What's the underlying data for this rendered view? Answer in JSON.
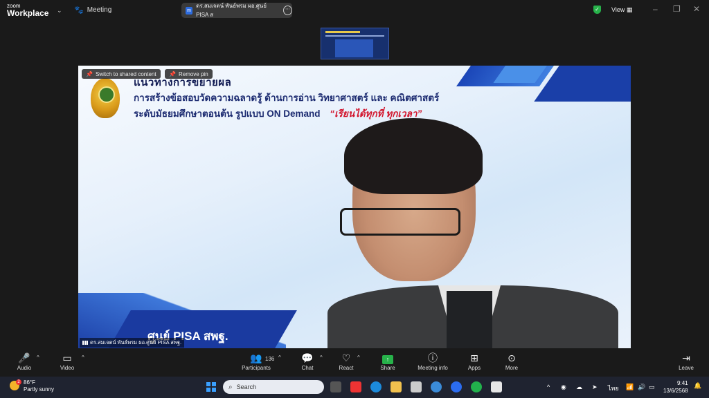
{
  "app": {
    "logo_line1": "zoom",
    "logo_line2": "Workplace",
    "meeting_label": "Meeting",
    "view_label": "View"
  },
  "speaker_pill": {
    "text": "ดร.สมเจตน์ พันธ์พรม ผอ.ศูนย์ PISA ส"
  },
  "slide": {
    "title": "แนวทางการขยายผล",
    "line1": "การสร้างข้อสอบวัดความฉลาดรู้ ด้านการอ่าน วิทยาศาสตร์ และ คณิตศาสตร์",
    "line2": "ระดับมัธยมศึกษาตอนต้น รูปแบบ ON Demand",
    "line2_highlight": "“เรียนได้ทุกที่ ทุกเวลา”",
    "brand": "ศูนย์ PISA สพฐ."
  },
  "overlay": {
    "switch_label": "Switch to shared content",
    "remove_pin_label": "Remove pin"
  },
  "video_name": "ดร.สมเจตน์ พันธ์พรม ผอ.ศูนย์ PISA สพฐ.",
  "controls": {
    "audio": "Audio",
    "video": "Video",
    "participants": "Participants",
    "participants_count": "136",
    "chat": "Chat",
    "react": "React",
    "share": "Share",
    "meeting_info": "Meeting info",
    "apps": "Apps",
    "more": "More",
    "leave": "Leave"
  },
  "taskbar": {
    "temp": "86°F",
    "weather": "Partly sunny",
    "weather_badge": "2",
    "search_placeholder": "Search",
    "lang": "ไทย",
    "time": "9:41",
    "date": "13/6/2568"
  },
  "colors": {
    "accent": "#27b24a",
    "leave": "#e0303b",
    "slide_blue": "#1a3fa8",
    "highlight": "#d2132b"
  }
}
